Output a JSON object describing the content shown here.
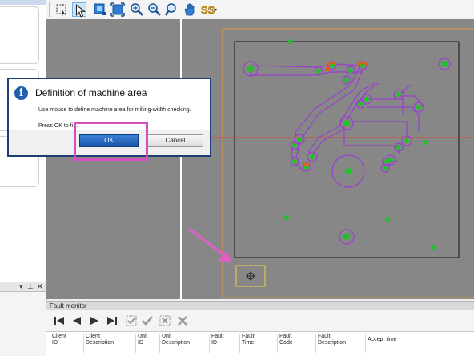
{
  "dialog": {
    "title": "Definition of machine area",
    "message": "Use mouse to define machine area for milling-width checking.",
    "message2": "Press OK to fi...",
    "ok_label": "OK",
    "cancel_label": "Cancel"
  },
  "fault_monitor": {
    "title": "Fault monitor",
    "columns": [
      "Client\nID",
      "Client\nDescription",
      "Unit\nID",
      "Unit\nDescription",
      "Fault\nID",
      "Fault\nTime",
      "Fault\nCode",
      "Fault\nDescription",
      "Accept time"
    ]
  },
  "toolbar": {
    "icons": [
      "select-rectangle-icon",
      "pointer-icon",
      "zoom-window-icon",
      "zoom-extents-icon",
      "zoom-in-icon",
      "zoom-out-icon",
      "pan-hand-icon",
      "special-tool-icon"
    ]
  },
  "colors": {
    "canvas_bg": "#878787",
    "dialog_border": "#1c3f73",
    "highlight": "#d44ec0",
    "track": "#9a3fcf",
    "pad": "#22c02a",
    "crosshair": "#e0452a",
    "board_outline": "#e39a4b"
  }
}
